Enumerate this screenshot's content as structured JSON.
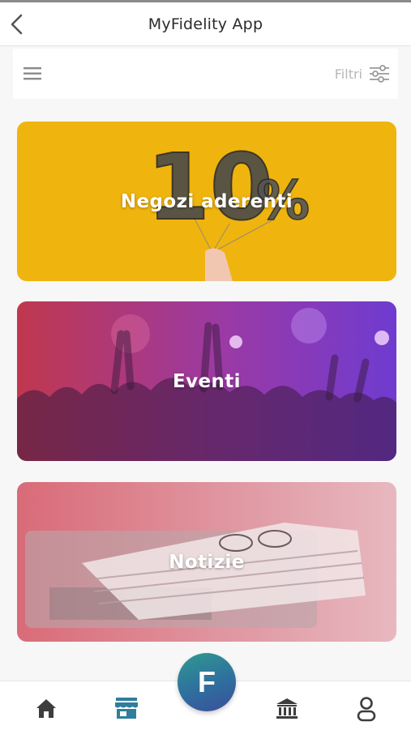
{
  "header": {
    "title": "MyFidelity App",
    "back_icon": "chevron-left-icon"
  },
  "toolbar": {
    "menu_icon": "hamburger-menu-icon",
    "filter_label": "Filtri",
    "filter_icon": "sliders-icon"
  },
  "cards": [
    {
      "label": "Negozi aderenti",
      "image": "balloons-10-percent",
      "color": "#f0b40e"
    },
    {
      "label": "Eventi",
      "image": "concert-crowd",
      "color": "#9a3aa6"
    },
    {
      "label": "Notizie",
      "image": "newspaper-laptop",
      "color": "#d96b78"
    }
  ],
  "bottom_nav": {
    "items": [
      "home-icon",
      "store-icon",
      "bank-icon",
      "user-icon"
    ],
    "active": "store-icon",
    "fab_letter": "F",
    "active_color": "#2f7e9e"
  }
}
